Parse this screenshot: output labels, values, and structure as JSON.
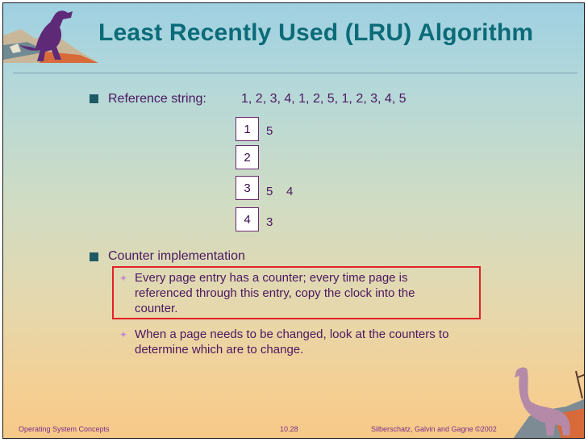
{
  "slide": {
    "title": "Least Recently Used (LRU) Algorithm",
    "bullet1": {
      "label": "Reference string:",
      "value": "1, 2, 3, 4, 1, 2, 5, 1, 2, 3, 4, 5"
    },
    "frames": [
      "1",
      "2",
      "3",
      "4"
    ],
    "replacements": [
      "5",
      "",
      "5    4",
      "3"
    ],
    "bullet2": {
      "label": "Counter implementation",
      "subs": [
        [
          "Every page entry has a counter; every time page is",
          "referenced through this entry, copy the clock into the",
          "counter."
        ],
        [
          "When a page needs to be changed, look at the counters to",
          "determine which are to change."
        ]
      ]
    },
    "footer": {
      "left": "Operating System Concepts",
      "center": "10.28",
      "right": "Silberschatz, Galvin and  Gagne ©2002"
    }
  },
  "icons": [
    "dinosaur-icon",
    "dinosaur-icon"
  ],
  "colors": {
    "title": "#0b6b78",
    "body": "#4a1860",
    "highlight": "#e2202a"
  }
}
